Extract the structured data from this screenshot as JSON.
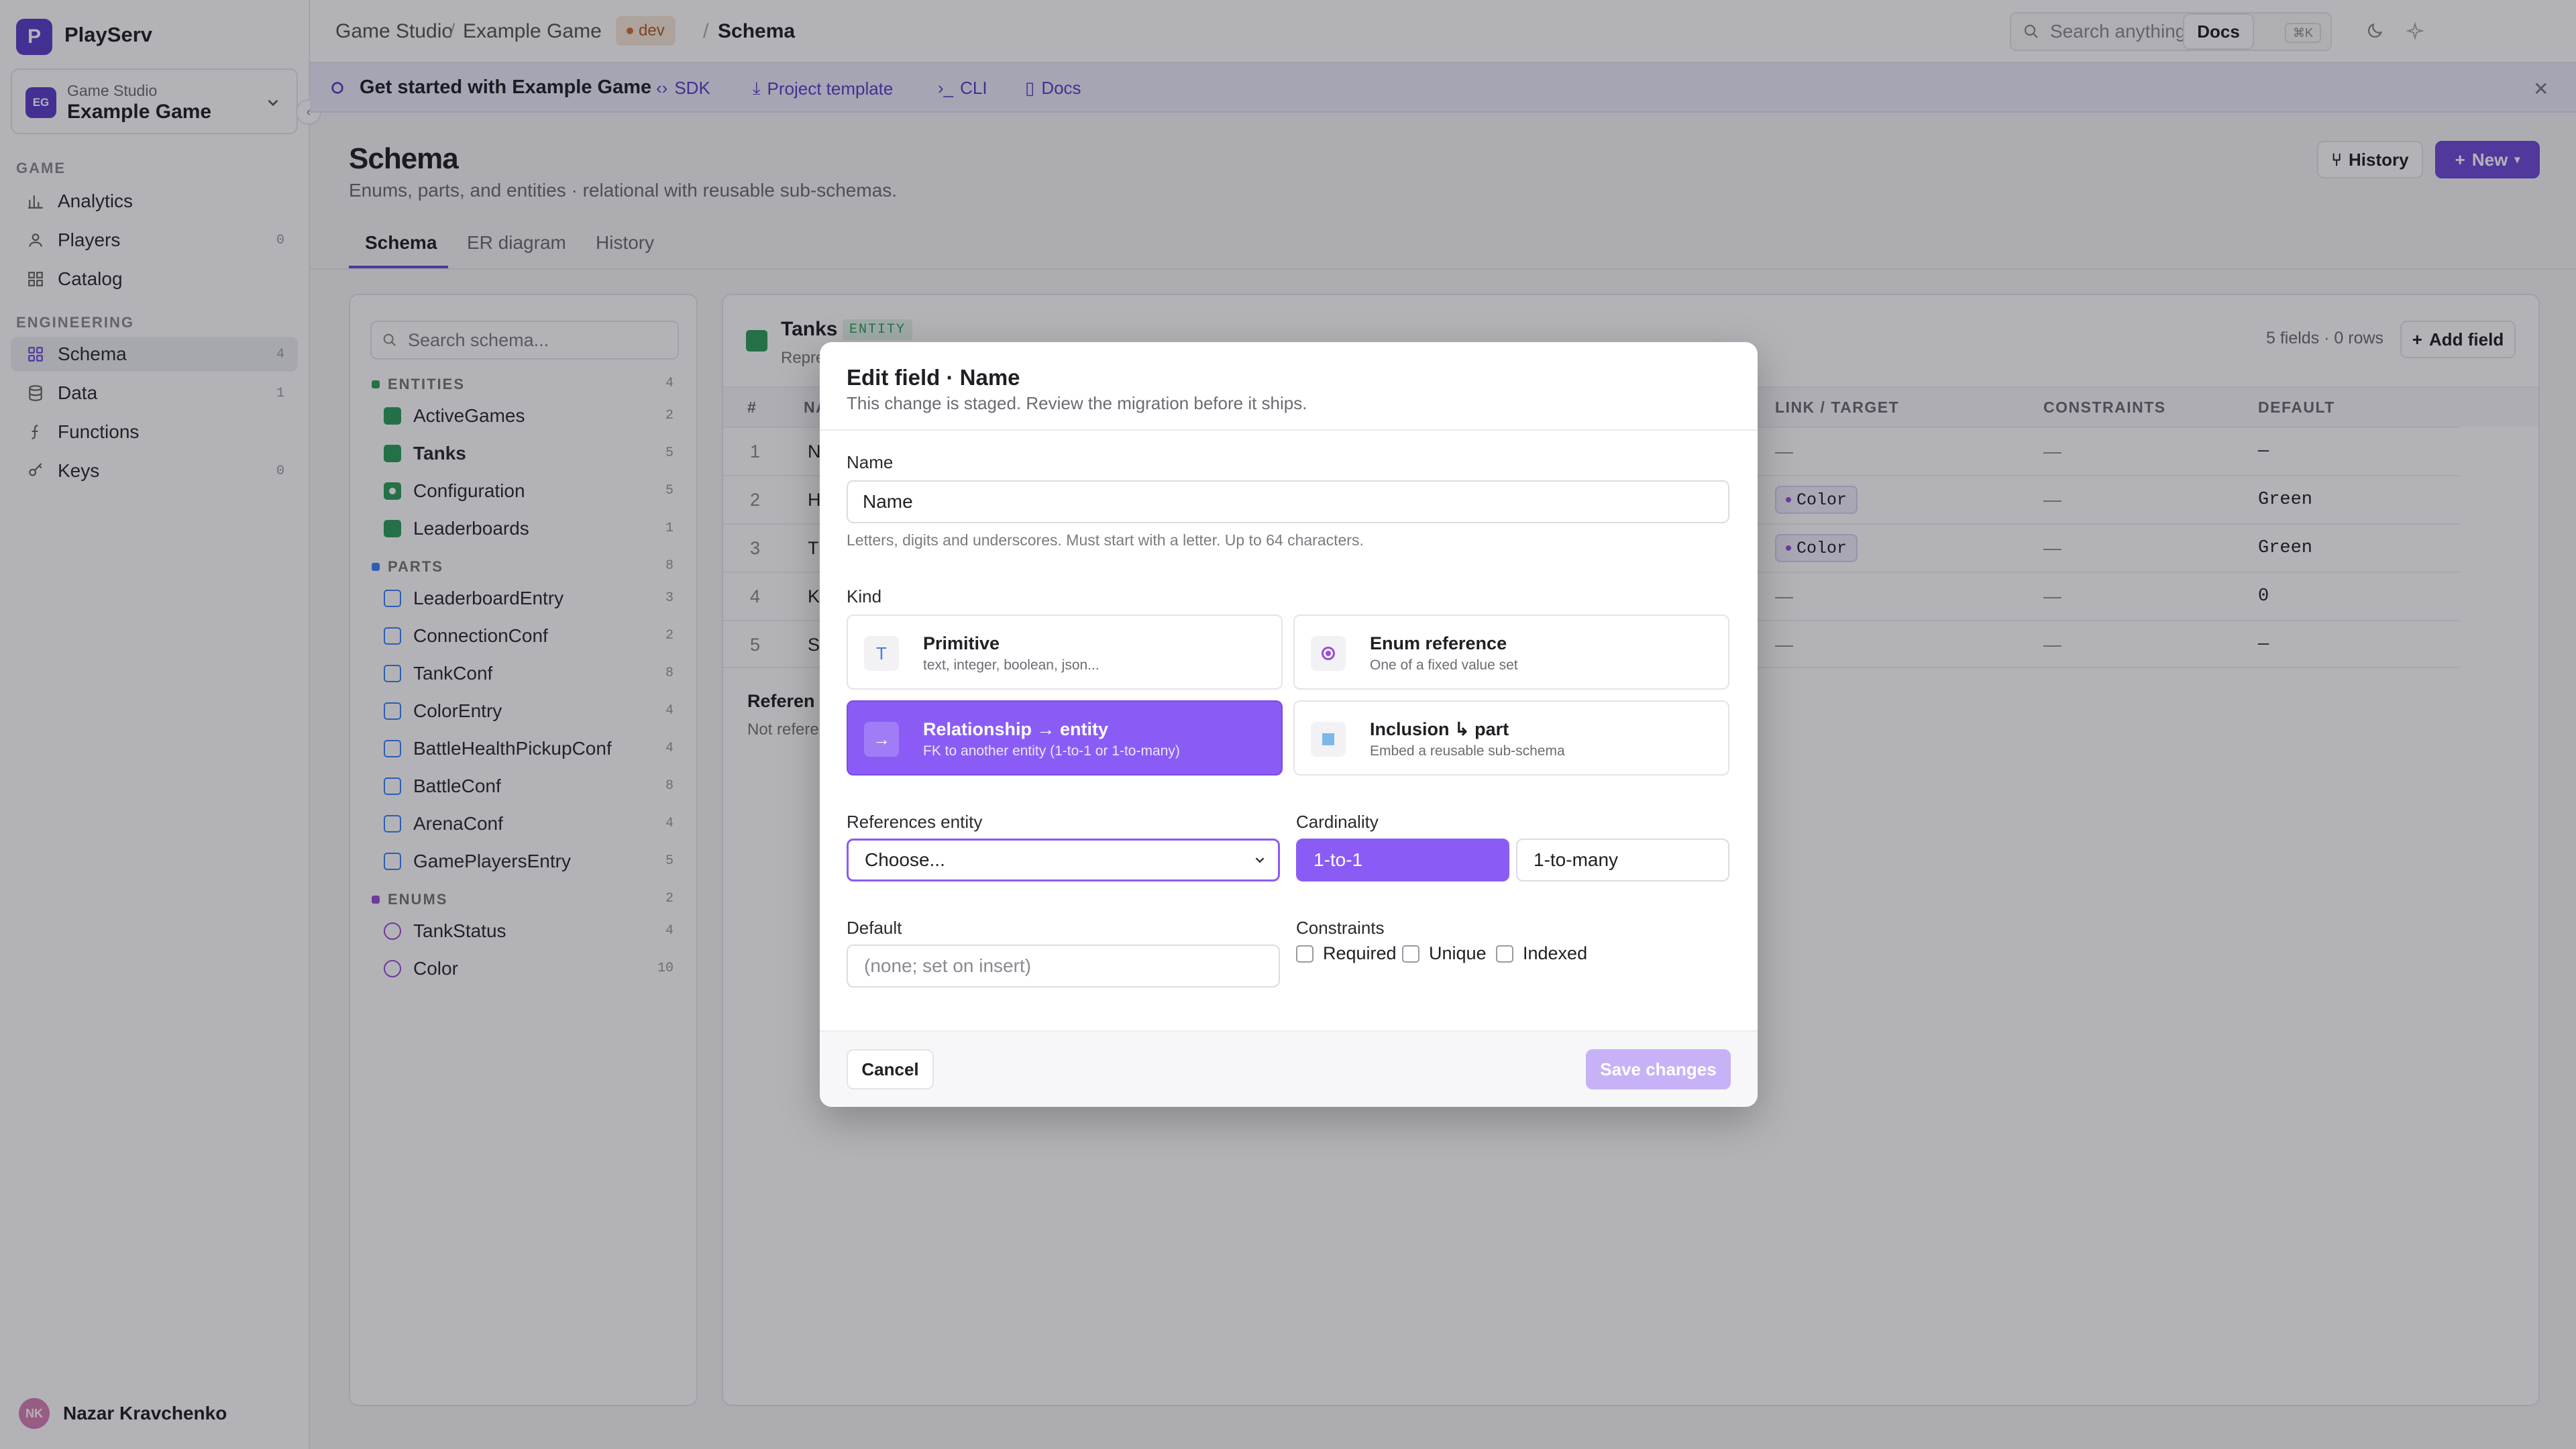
{
  "app": {
    "name": "PlaySer",
    "name_full": "PlayServ",
    "logo_letter": "P"
  },
  "project": {
    "avatar": "EG",
    "studio": "Game Studio",
    "name": "Example Game"
  },
  "sidebar": {
    "sections": [
      {
        "title": "GAME",
        "items": [
          {
            "label": "Analytics",
            "icon": "analytics-icon",
            "count": ""
          },
          {
            "label": "Players",
            "icon": "players-icon",
            "count": "0"
          },
          {
            "label": "Catalog",
            "icon": "catalog-icon",
            "count": ""
          }
        ]
      },
      {
        "title": "ENGINEERING",
        "items": [
          {
            "label": "Schema",
            "icon": "schema-icon",
            "count": "4"
          },
          {
            "label": "Data",
            "icon": "data-icon",
            "count": "1"
          },
          {
            "label": "Functions",
            "icon": "functions-icon",
            "count": ""
          },
          {
            "label": "Keys",
            "icon": "keys-icon",
            "count": "0"
          }
        ]
      }
    ],
    "user": {
      "initials": "NK",
      "name": "Nazar Kravchenko"
    }
  },
  "topbar": {
    "breadcrumb": [
      "Game Studio",
      "Example Game",
      "dev",
      "Schema"
    ],
    "search_placeholder": "Search anything",
    "shortcut": "⌘K",
    "docs_label": "Docs"
  },
  "banner": {
    "title": "Get started with Example Game",
    "links": [
      "SDK",
      "Project template",
      "CLI",
      "Docs"
    ]
  },
  "page": {
    "title": "Schema",
    "subtitle": "Enums, parts, and entities · relational with reusable sub-schemas.",
    "history_label": "History",
    "new_label": "New",
    "tabs": [
      "Schema",
      "ER diagram",
      "History"
    ]
  },
  "tree": {
    "search_placeholder": "Search schema...",
    "groups": [
      {
        "title": "ENTITIES",
        "count": "4",
        "color": "#2e9e5b",
        "items": [
          {
            "label": "ActiveGames",
            "count": "2"
          },
          {
            "label": "Tanks",
            "count": "5"
          },
          {
            "label": "Configuration",
            "count": "5"
          },
          {
            "label": "Leaderboards",
            "count": "1"
          }
        ]
      },
      {
        "title": "PARTS",
        "count": "8",
        "color": "#3b82f6",
        "items": [
          {
            "label": "LeaderboardEntry",
            "count": "3"
          },
          {
            "label": "ConnectionConf",
            "count": "2"
          },
          {
            "label": "TankConf",
            "count": "8"
          },
          {
            "label": "ColorEntry",
            "count": "4"
          },
          {
            "label": "BattleHealthPickupConf",
            "count": "4"
          },
          {
            "label": "BattleConf",
            "count": "8"
          },
          {
            "label": "ArenaConf",
            "count": "4"
          },
          {
            "label": "GamePlayersEntry",
            "count": "5"
          }
        ]
      },
      {
        "title": "ENUMS",
        "count": "2",
        "color": "#9b4dd6",
        "items": [
          {
            "label": "TankStatus",
            "count": "4"
          },
          {
            "label": "Color",
            "count": "10"
          }
        ]
      }
    ]
  },
  "entity": {
    "name": "Tanks",
    "badge": "ENTITY",
    "desc_partial": "Repre",
    "meta": "5 fields · 0 rows",
    "add_field_label": "Add field",
    "columns": [
      "#",
      "NA",
      "LINK / TARGET",
      "CONSTRAINTS",
      "DEFAULT"
    ],
    "rows": [
      {
        "n": "1",
        "name": "N",
        "link": "—",
        "constraints": "—",
        "default": "—"
      },
      {
        "n": "2",
        "name": "H",
        "link": "Color",
        "constraints": "—",
        "default": "Green"
      },
      {
        "n": "3",
        "name": "T",
        "link": "Color",
        "constraints": "—",
        "default": "Green"
      },
      {
        "n": "4",
        "name": "K",
        "link": "—",
        "constraints": "—",
        "default": "0"
      },
      {
        "n": "5",
        "name": "S",
        "link": "—",
        "constraints": "—",
        "default": "—"
      }
    ],
    "refs_title": "Referen",
    "refs_text": "Not refere"
  },
  "modal": {
    "title": "Edit field · Name",
    "subtitle": "This change is staged. Review the migration before it ships.",
    "name_label": "Name",
    "name_value": "Name",
    "name_hint": "Letters, digits and underscores. Must start with a letter. Up to 64 characters.",
    "kind_label": "Kind",
    "kinds": [
      {
        "title": "Primitive",
        "desc": "text, integer, boolean, json..."
      },
      {
        "title": "Enum reference",
        "desc": "One of a fixed value set"
      },
      {
        "title": "Relationship → entity",
        "desc": "FK to another entity (1-to-1 or 1-to-many)"
      },
      {
        "title": "Inclusion ↳ part",
        "desc": "Embed a reusable sub-schema"
      }
    ],
    "ref_label": "References entity",
    "ref_value": "Choose...",
    "card_label": "Cardinality",
    "card_options": [
      "1-to-1",
      "1-to-many"
    ],
    "default_label": "Default",
    "default_placeholder": "(none; set on insert)",
    "constraints_label": "Constraints",
    "constraints": [
      "Required",
      "Unique",
      "Indexed"
    ],
    "cancel_label": "Cancel",
    "save_label": "Save changes",
    "accent": "#8a5cf5"
  }
}
